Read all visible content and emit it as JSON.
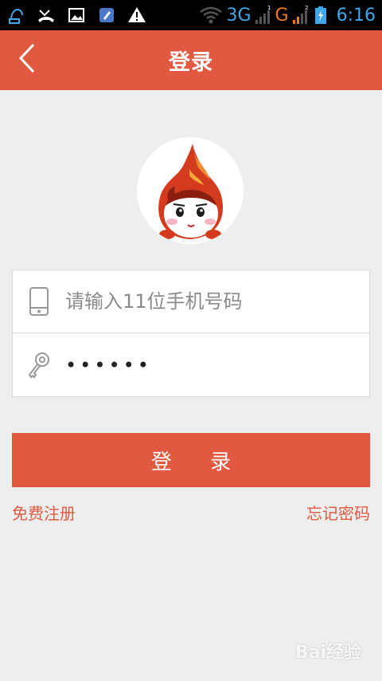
{
  "status_bar": {
    "net1": "3G",
    "net1_sup": "1",
    "net2": "G",
    "net2_sup": "2",
    "time": "6:16",
    "icons": [
      "sync-icon",
      "missed-call-icon",
      "gallery-icon",
      "cleaner-icon",
      "warning-icon",
      "wifi-icon",
      "signal-icon",
      "battery-icon"
    ]
  },
  "header": {
    "title": "登录",
    "back_icon": "chevron-left-icon"
  },
  "form": {
    "phone_placeholder": "请输入11位手机号码",
    "password_value": "••••••",
    "phone_icon": "phone-icon",
    "key_icon": "key-icon"
  },
  "login_button": "登 录",
  "links": {
    "register": "免费注册",
    "forgot": "忘记密码"
  },
  "watermark": "Bai经验",
  "colors": {
    "accent": "#e05940",
    "background": "#eeeeee",
    "status_blue": "#3ea8e8"
  }
}
